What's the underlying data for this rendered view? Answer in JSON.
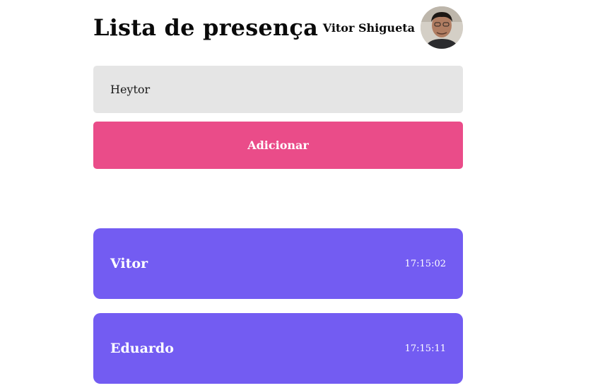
{
  "header": {
    "title": "Lista de presença",
    "user_name": "Vitor Shigueta"
  },
  "form": {
    "input_value": "Heytor",
    "add_label": "Adicionar"
  },
  "attendees": [
    {
      "name": "Vitor",
      "time": "17:15:02"
    },
    {
      "name": "Eduardo",
      "time": "17:15:11"
    }
  ],
  "colors": {
    "accent_button": "#ea4c89",
    "card_background": "#735cf2",
    "input_background": "#e5e5e5"
  }
}
